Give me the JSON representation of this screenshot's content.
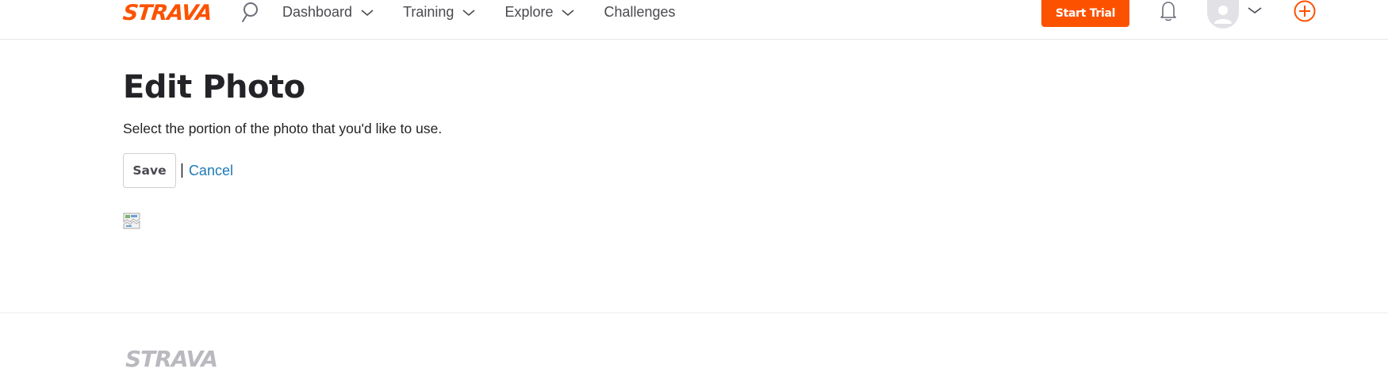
{
  "brand": {
    "name": "STRAVA",
    "accent_color": "#fc5200",
    "link_color": "#1f7ab5"
  },
  "header": {
    "logo_text": "STRAVA",
    "search_icon": "search-icon",
    "nav": [
      {
        "label": "Dashboard",
        "has_menu": true
      },
      {
        "label": "Training",
        "has_menu": true
      },
      {
        "label": "Explore",
        "has_menu": true
      },
      {
        "label": "Challenges",
        "has_menu": false
      }
    ],
    "start_trial_label": "Start Trial",
    "notifications_icon": "bell-icon",
    "avatar_icon": "user-avatar-icon",
    "add_icon": "plus-circle-icon"
  },
  "main": {
    "title": "Edit Photo",
    "instructions": "Select the portion of the photo that you'd like to use.",
    "save_label": "Save",
    "separator": "|",
    "cancel_label": "Cancel",
    "photo_icon": "broken-image-icon"
  },
  "footer": {
    "logo_text": "STRAVA"
  }
}
